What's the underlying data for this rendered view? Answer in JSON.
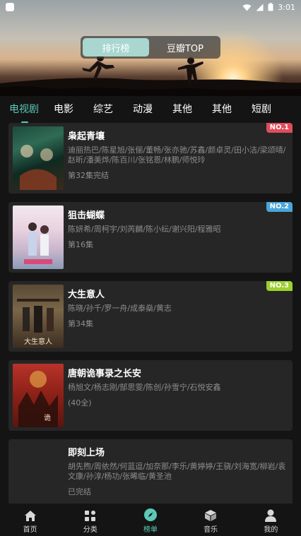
{
  "status_bar": {
    "time": "3:01"
  },
  "segment": {
    "options": [
      "排行榜",
      "豆瓣TOP"
    ]
  },
  "tabs": [
    "电视剧",
    "电影",
    "综艺",
    "动漫",
    "其他",
    "其他",
    "短剧"
  ],
  "list": [
    {
      "title": "枭起青壤",
      "cast": "迪丽热巴/陈星旭/张俪/董畅/张亦驰/苏鑫/颜卓灵/田小洁/梁颂晴/赵昕/潘美烨/陈百川/张铭恩/林鹏/师悦玲",
      "status": "第32集完结",
      "rank": "NO.1",
      "rank_color": "#e24b5b"
    },
    {
      "title": "狙击蝴蝶",
      "cast": "陈妍希/周柯宇/刘芮麟/陈小纭/谢兴阳/程雅昭",
      "status": "第16集",
      "rank": "NO.2",
      "rank_color": "#4aa6d8"
    },
    {
      "title": "大生意人",
      "cast": "陈晓/孙千/罗一舟/成泰燊/黄志",
      "status": "第34集",
      "rank": "NO.3",
      "rank_color": "#9bd12d"
    },
    {
      "title": "唐朝诡事录之长安",
      "cast": "杨旭文/杨志刚/郜思雯/陈创/孙雪宁/石悦安鑫",
      "status": "(40全)",
      "rank": "",
      "rank_color": ""
    },
    {
      "title": "即刻上场",
      "cast": "胡先煦/周依然/何蓝逗/加奈那/李乐/黄婷婷/王骁/刘海宽/柳岩/袁文康/孙淳/杨功/张晞临/黄圣池",
      "status": "已完结",
      "rank": "",
      "rank_color": ""
    }
  ],
  "bottom_nav": [
    {
      "label": "首页",
      "icon": "home-icon"
    },
    {
      "label": "分类",
      "icon": "category-icon"
    },
    {
      "label": "榜单",
      "icon": "compass-icon"
    },
    {
      "label": "音乐",
      "icon": "music-box-icon"
    },
    {
      "label": "我的",
      "icon": "profile-icon"
    }
  ]
}
